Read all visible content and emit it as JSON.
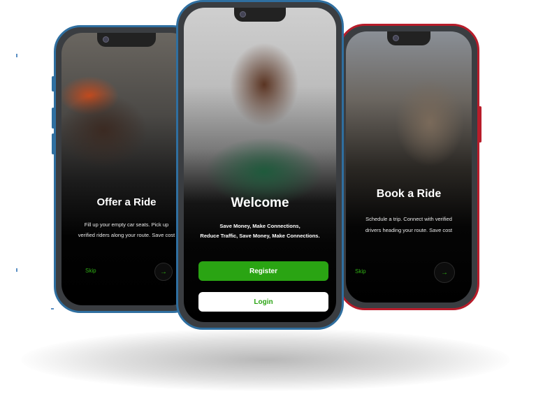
{
  "screens": {
    "left": {
      "title": "Offer a Ride",
      "subtitle_line1": "Fill up your empty car seats. Pick up",
      "subtitle_line2": "verified riders along your route. Save cost",
      "skip_label": "Skip",
      "next_icon": "→"
    },
    "center": {
      "title": "Welcome",
      "subtitle_line1": "Save Money, Make Connections,",
      "subtitle_line2": "Reduce Traffic, Save Money, Make Connections.",
      "register_label": "Register",
      "login_label": "Login"
    },
    "right": {
      "title": "Book a Ride",
      "subtitle_line1": "Schedule a trip. Connect with verified",
      "subtitle_line2": "drivers heading your route. Save cost",
      "skip_label": "Skip",
      "next_icon": "→"
    }
  },
  "colors": {
    "accent_green": "#2aa413",
    "frame_blue": "#2f6fa0",
    "frame_red": "#b81c2a"
  }
}
